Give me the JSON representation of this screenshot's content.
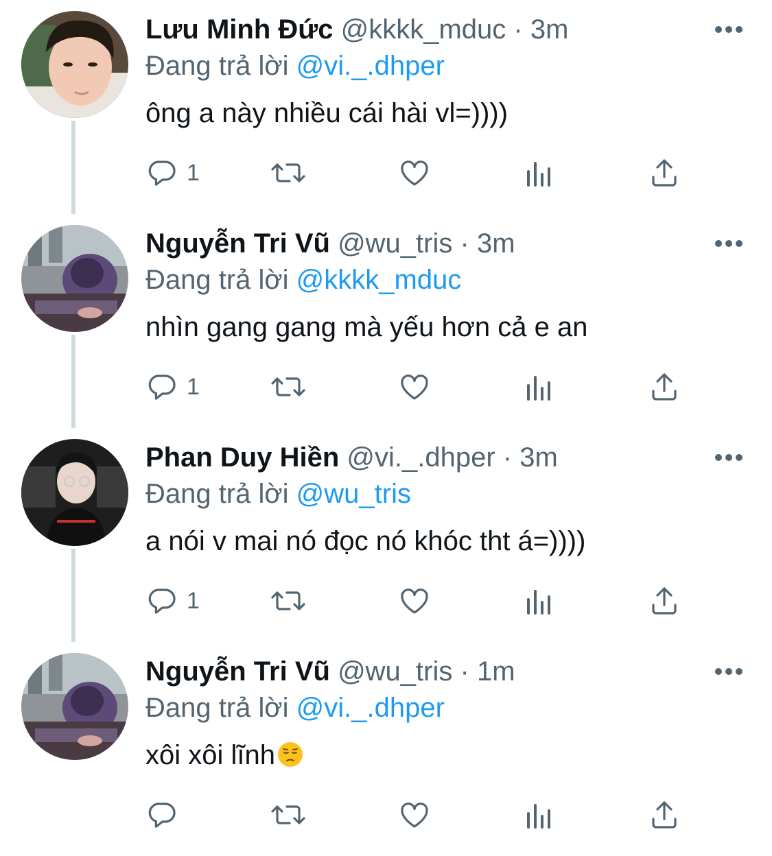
{
  "colors": {
    "accent": "#1d9bf0",
    "text": "#0f1419",
    "secondary": "#536471",
    "thread_line": "#cfd9de"
  },
  "tweets": [
    {
      "name": "Lưu Minh Đức",
      "handle": "@kkkk_mduc",
      "sep": "·",
      "time": "3m",
      "reply_prefix": "Đang trả lời",
      "reply_to": "@vi._.dhper",
      "text": "ông a này nhiều cái hài vl=))))",
      "reply_count": "1",
      "avatar_icon": "profile-photo"
    },
    {
      "name": "Nguyễn Tri Vũ",
      "handle": "@wu_tris",
      "sep": "·",
      "time": "3m",
      "reply_prefix": "Đang trả lời",
      "reply_to": "@kkkk_mduc",
      "text": "nhìn gang gang mà yếu hơn cả e an",
      "reply_count": "1",
      "avatar_icon": "profile-photo"
    },
    {
      "name": "Phan Duy Hiền",
      "handle": "@vi._.dhper",
      "sep": "·",
      "time": "3m",
      "reply_prefix": "Đang trả lời",
      "reply_to": "@wu_tris",
      "text": "a nói v mai nó đọc nó khóc tht á=))))",
      "reply_count": "1",
      "avatar_icon": "profile-photo"
    },
    {
      "name": "Nguyễn Tri Vũ",
      "handle": "@wu_tris",
      "sep": "·",
      "time": "1m",
      "reply_prefix": "Đang trả lời",
      "reply_to": "@vi._.dhper",
      "text": "xôi xôi lĩnh",
      "reply_count": "",
      "avatar_icon": "profile-photo",
      "trailing_emoji": "pensive-face-emoji"
    }
  ],
  "icons": {
    "reply": "reply-icon",
    "retweet": "retweet-icon",
    "like": "heart-icon",
    "analytics": "analytics-icon",
    "share": "share-icon",
    "more": "more-icon"
  }
}
